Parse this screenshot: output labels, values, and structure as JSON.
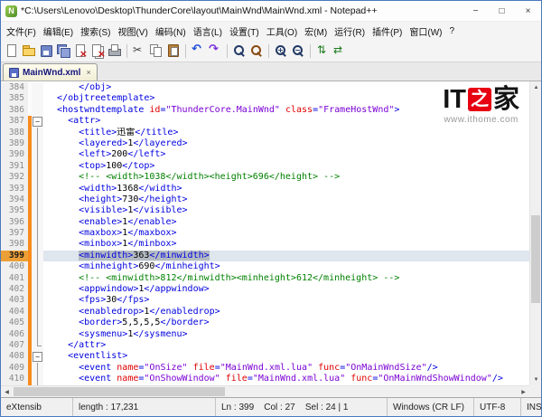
{
  "colors": {
    "tag": "#0000e0",
    "attr": "#e00000",
    "value": "#7a00d4",
    "comment": "#008000",
    "selection": "#b3bac1",
    "accent_border": "#4a79bd",
    "watermark_red": "#e60012",
    "change_marker": "#f98b1c"
  },
  "window": {
    "title": "*C:\\Users\\Lenovo\\Desktop\\ThunderCore\\layout\\MainWnd\\MainWnd.xml - Notepad++",
    "controls": {
      "minimize": "−",
      "maximize": "□",
      "close": "×"
    }
  },
  "menu": {
    "items": [
      {
        "name": "file",
        "label": "文件(F)"
      },
      {
        "name": "edit",
        "label": "编辑(E)"
      },
      {
        "name": "search",
        "label": "搜索(S)"
      },
      {
        "name": "view",
        "label": "视图(V)"
      },
      {
        "name": "encoding",
        "label": "编码(N)"
      },
      {
        "name": "language",
        "label": "语言(L)"
      },
      {
        "name": "settings",
        "label": "设置(T)"
      },
      {
        "name": "tools",
        "label": "工具(O)"
      },
      {
        "name": "macro",
        "label": "宏(M)"
      },
      {
        "name": "run",
        "label": "运行(R)"
      },
      {
        "name": "plugins",
        "label": "插件(P)"
      },
      {
        "name": "window",
        "label": "窗口(W)"
      },
      {
        "name": "help",
        "label": "?"
      }
    ]
  },
  "toolbar": {
    "icons": [
      "new-file",
      "open-folder",
      "save",
      "save-all",
      "close-file",
      "close-all",
      "print",
      "|",
      "cut",
      "copy",
      "paste",
      "|",
      "undo",
      "redo",
      "|",
      "find",
      "replace",
      "|",
      "zoom-in",
      "zoom-out",
      "|",
      "sync-vertical",
      "sync-horizontal"
    ]
  },
  "tabs": [
    {
      "label": "MainWnd.xml",
      "close": "×"
    }
  ],
  "editor": {
    "indent_size": 2,
    "first_line": 384,
    "lines": [
      {
        "n": 384,
        "ind": 3,
        "tokens": [
          [
            "g",
            "</obj>"
          ]
        ]
      },
      {
        "n": 385,
        "ind": 1,
        "tokens": [
          [
            "g",
            "</objtreetemplate>"
          ]
        ]
      },
      {
        "n": 386,
        "ind": 1,
        "tokens": [
          [
            "g",
            "<hostwndtemplate "
          ],
          [
            "a",
            "id"
          ],
          [
            "g",
            "="
          ],
          [
            "v",
            "\"ThunderCore.MainWnd\""
          ],
          [
            "t",
            " "
          ],
          [
            "a",
            "class"
          ],
          [
            "g",
            "="
          ],
          [
            "v",
            "\"FrameHostWnd\""
          ],
          [
            "g",
            ">"
          ]
        ]
      },
      {
        "n": 387,
        "ind": 2,
        "chg": true,
        "fold": "box",
        "tokens": [
          [
            "g",
            "<attr>"
          ]
        ]
      },
      {
        "n": 388,
        "ind": 3,
        "chg": true,
        "fold": "line",
        "tokens": [
          [
            "g",
            "<title>"
          ],
          [
            "t",
            "迅雷"
          ],
          [
            "g",
            "</title>"
          ]
        ]
      },
      {
        "n": 389,
        "ind": 3,
        "chg": true,
        "fold": "line",
        "tokens": [
          [
            "g",
            "<layered>"
          ],
          [
            "t",
            "1"
          ],
          [
            "g",
            "</layered>"
          ]
        ]
      },
      {
        "n": 390,
        "ind": 3,
        "chg": true,
        "fold": "line",
        "tokens": [
          [
            "g",
            "<left>"
          ],
          [
            "t",
            "200"
          ],
          [
            "g",
            "</left>"
          ]
        ]
      },
      {
        "n": 391,
        "ind": 3,
        "chg": true,
        "fold": "line",
        "tokens": [
          [
            "g",
            "<top>"
          ],
          [
            "t",
            "100"
          ],
          [
            "g",
            "</top>"
          ]
        ]
      },
      {
        "n": 392,
        "ind": 3,
        "chg": true,
        "fold": "line",
        "tokens": [
          [
            "c",
            "<!-- <width>1038</width><height>696</height> -->"
          ]
        ]
      },
      {
        "n": 393,
        "ind": 3,
        "chg": true,
        "fold": "line",
        "tokens": [
          [
            "g",
            "<width>"
          ],
          [
            "t",
            "1368"
          ],
          [
            "g",
            "</width>"
          ]
        ]
      },
      {
        "n": 394,
        "ind": 3,
        "chg": true,
        "fold": "line",
        "tokens": [
          [
            "g",
            "<height>"
          ],
          [
            "t",
            "730"
          ],
          [
            "g",
            "</height>"
          ]
        ]
      },
      {
        "n": 395,
        "ind": 3,
        "chg": true,
        "fold": "line",
        "tokens": [
          [
            "g",
            "<visible>"
          ],
          [
            "t",
            "1"
          ],
          [
            "g",
            "</visible>"
          ]
        ]
      },
      {
        "n": 396,
        "ind": 3,
        "chg": true,
        "fold": "line",
        "tokens": [
          [
            "g",
            "<enable>"
          ],
          [
            "t",
            "1"
          ],
          [
            "g",
            "</enable>"
          ]
        ]
      },
      {
        "n": 397,
        "ind": 3,
        "chg": true,
        "fold": "line",
        "tokens": [
          [
            "g",
            "<maxbox>"
          ],
          [
            "t",
            "1"
          ],
          [
            "g",
            "</maxbox>"
          ]
        ]
      },
      {
        "n": 398,
        "ind": 3,
        "chg": true,
        "fold": "line",
        "tokens": [
          [
            "g",
            "<minbox>"
          ],
          [
            "t",
            "1"
          ],
          [
            "g",
            "</minbox>"
          ]
        ]
      },
      {
        "n": 399,
        "ind": 3,
        "chg": true,
        "fold": "line",
        "cur": true,
        "sel": true,
        "tokens": [
          [
            "g",
            "<minwidth>"
          ],
          [
            "t",
            "363"
          ],
          [
            "g",
            "</minwidth>"
          ]
        ]
      },
      {
        "n": 400,
        "ind": 3,
        "chg": true,
        "fold": "line",
        "tokens": [
          [
            "g",
            "<minheight>"
          ],
          [
            "t",
            "690"
          ],
          [
            "g",
            "</minheight>"
          ]
        ]
      },
      {
        "n": 401,
        "ind": 3,
        "chg": true,
        "fold": "line",
        "tokens": [
          [
            "c",
            "<!-- <minwidth>812</minwidth><minheight>612</minheight> -->"
          ]
        ]
      },
      {
        "n": 402,
        "ind": 3,
        "chg": true,
        "fold": "line",
        "tokens": [
          [
            "g",
            "<appwindow>"
          ],
          [
            "t",
            "1"
          ],
          [
            "g",
            "</appwindow>"
          ]
        ]
      },
      {
        "n": 403,
        "ind": 3,
        "chg": true,
        "fold": "line",
        "tokens": [
          [
            "g",
            "<fps>"
          ],
          [
            "t",
            "30"
          ],
          [
            "g",
            "</fps>"
          ]
        ]
      },
      {
        "n": 404,
        "ind": 3,
        "chg": true,
        "fold": "line",
        "tokens": [
          [
            "g",
            "<enabledrop>"
          ],
          [
            "t",
            "1"
          ],
          [
            "g",
            "</enabledrop>"
          ]
        ]
      },
      {
        "n": 405,
        "ind": 3,
        "chg": true,
        "fold": "line",
        "tokens": [
          [
            "g",
            "<border>"
          ],
          [
            "t",
            "5,5,5,5"
          ],
          [
            "g",
            "</border>"
          ]
        ]
      },
      {
        "n": 406,
        "ind": 3,
        "chg": true,
        "fold": "line",
        "tokens": [
          [
            "g",
            "<sysmenu>"
          ],
          [
            "t",
            "1"
          ],
          [
            "g",
            "</sysmenu>"
          ]
        ]
      },
      {
        "n": 407,
        "ind": 2,
        "chg": true,
        "fold": "end",
        "tokens": [
          [
            "g",
            "</attr>"
          ]
        ]
      },
      {
        "n": 408,
        "ind": 2,
        "chg": true,
        "fold": "box",
        "tokens": [
          [
            "g",
            "<eventlist>"
          ]
        ]
      },
      {
        "n": 409,
        "ind": 3,
        "chg": true,
        "fold": "line",
        "tokens": [
          [
            "g",
            "<event "
          ],
          [
            "a",
            "name"
          ],
          [
            "g",
            "="
          ],
          [
            "v",
            "\"OnSize\""
          ],
          [
            "t",
            " "
          ],
          [
            "a",
            "file"
          ],
          [
            "g",
            "="
          ],
          [
            "v",
            "\"MainWnd.xml.lua\""
          ],
          [
            "t",
            " "
          ],
          [
            "a",
            "func"
          ],
          [
            "g",
            "="
          ],
          [
            "v",
            "\"OnMainWndSize\""
          ],
          [
            "g",
            "/>"
          ]
        ]
      },
      {
        "n": 410,
        "ind": 3,
        "chg": true,
        "fold": "line",
        "tokens": [
          [
            "g",
            "<event "
          ],
          [
            "a",
            "name"
          ],
          [
            "g",
            "="
          ],
          [
            "v",
            "\"OnShowWindow\""
          ],
          [
            "t",
            " "
          ],
          [
            "a",
            "file"
          ],
          [
            "g",
            "="
          ],
          [
            "v",
            "\"MainWnd.xml.lua\""
          ],
          [
            "t",
            " "
          ],
          [
            "a",
            "func"
          ],
          [
            "g",
            "="
          ],
          [
            "v",
            "\"OnMainWndShowWindow\""
          ],
          [
            "g",
            "/>"
          ]
        ]
      }
    ]
  },
  "watermark": {
    "it": "IT",
    "zhi": "之",
    "jia": "家",
    "url": "www.ithome.com"
  },
  "status": {
    "doctype": "eXtensib",
    "length": "length : 17,231",
    "position": "Ln : 399    Col : 27    Sel : 24 | 1",
    "eol": "Windows (CR LF)",
    "encoding": "UTF-8",
    "mode": "INS"
  }
}
